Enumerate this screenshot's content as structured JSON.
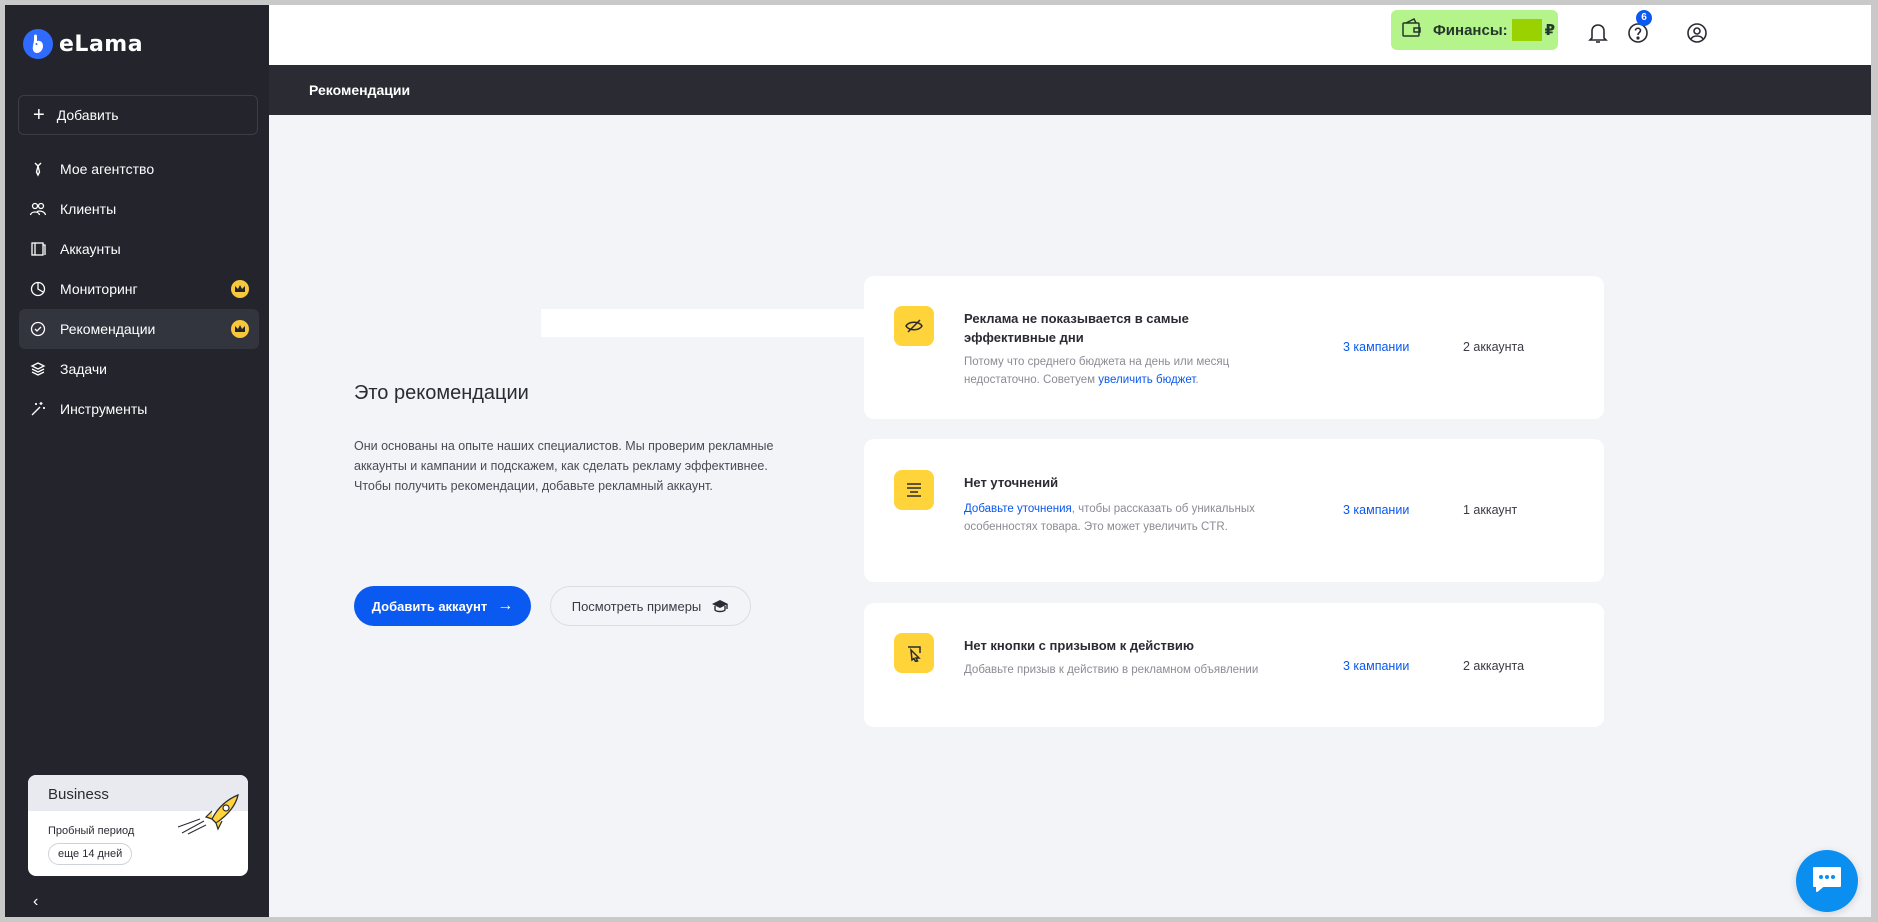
{
  "app": {
    "logo_text": "eLama"
  },
  "sidebar": {
    "add_label": "Добавить",
    "items": [
      {
        "label": "Мое агентство",
        "icon": "tie-icon"
      },
      {
        "label": "Клиенты",
        "icon": "users-icon"
      },
      {
        "label": "Аккаунты",
        "icon": "book-icon"
      },
      {
        "label": "Мониторинг",
        "icon": "chart-icon",
        "premium": true
      },
      {
        "label": "Рекомендации",
        "icon": "check-circle-icon",
        "premium": true,
        "active": true
      },
      {
        "label": "Задачи",
        "icon": "layers-icon"
      },
      {
        "label": "Инструменты",
        "icon": "magic-wand-icon"
      }
    ],
    "plan": {
      "name": "Business",
      "subtitle": "Пробный период",
      "days": "еще 14 дней"
    }
  },
  "topbar": {
    "finance_label": "Финансы:",
    "currency": "₽",
    "help_badge": "6"
  },
  "page": {
    "title": "Рекомендации"
  },
  "intro": {
    "title": "Это рекомендации",
    "text": "Они основаны на опыте наших специалистов. Мы проверим рекламные аккаунты и кампании и подскажем, как сделать рекламу эффективнее. Чтобы получить рекомендации, добавьте рекламный аккаунт.",
    "primary_button": "Добавить аккаунт",
    "secondary_button": "Посмотреть примеры"
  },
  "cards": [
    {
      "title": "Реклама не показывается в самые эффективные дни",
      "desc_before": "Потому что среднего бюджета на день или месяц недостаточно. Советуем ",
      "desc_link": "увеличить бюджет",
      "desc_after": ".",
      "campaigns": "3 кампании",
      "accounts": "2 аккаунта"
    },
    {
      "title": "Нет уточнений",
      "desc_before": "",
      "desc_link": "Добавьте уточнения",
      "desc_after": ", чтобы рассказать об уникальных особенностях товара. Это может увеличить CTR.",
      "campaigns": "3 кампании",
      "accounts": "1 аккаунт"
    },
    {
      "title": "Нет кнопки с призывом к действию",
      "desc_before": "Добавьте призыв к действию в рекламном объявлении",
      "desc_link": "",
      "desc_after": "",
      "campaigns": "3 кампании",
      "accounts": "2 аккаунта"
    }
  ],
  "colors": {
    "accent": "#0a59f0",
    "finance_bg": "#b5f48b",
    "card_icon": "#ffd43b",
    "sidebar_bg": "#23242c"
  }
}
